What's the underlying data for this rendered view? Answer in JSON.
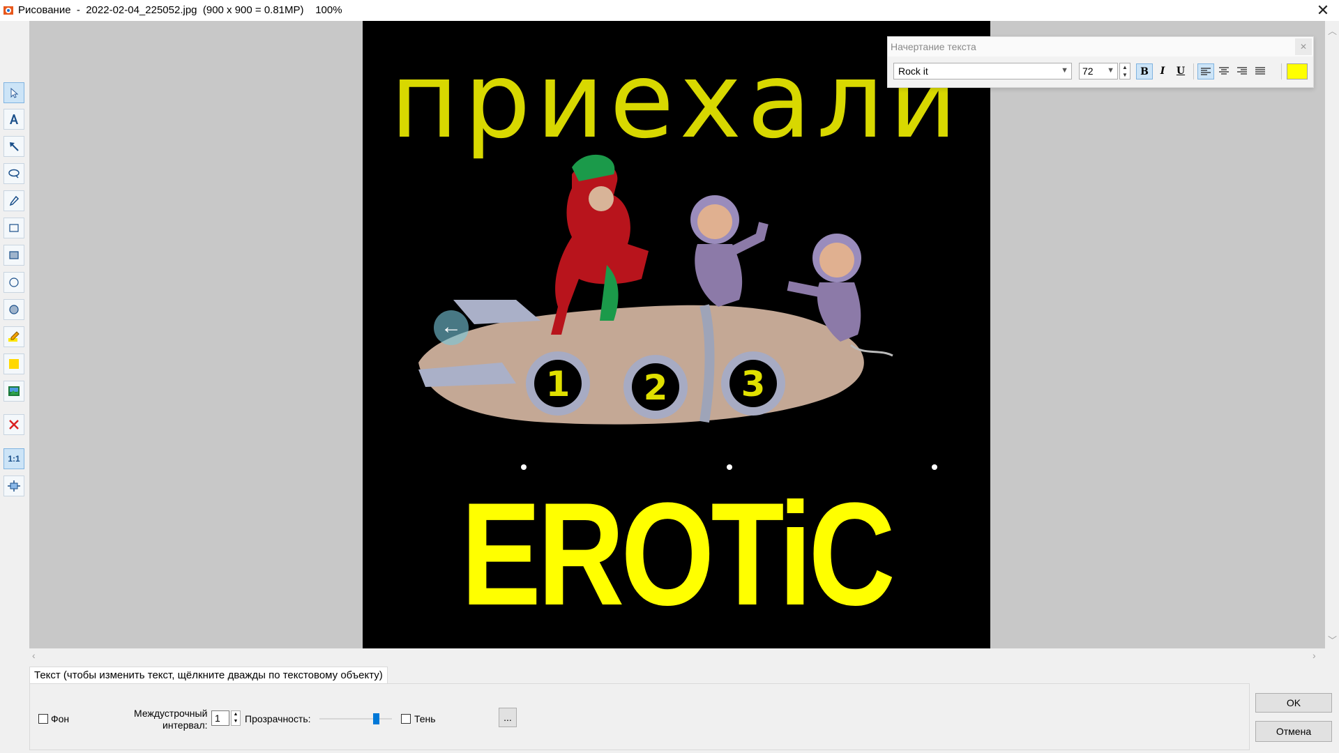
{
  "window": {
    "title": "Рисование  -  2022-02-04_225052.jpg  (900 x 900 = 0.81MP)    100%",
    "close_glyph": "✕"
  },
  "toolbar": {
    "icons": [
      "pointer-icon",
      "text-tool-icon",
      "arrow-tool-icon",
      "lasso-icon",
      "pen-icon",
      "rectangle-icon",
      "filled-rectangle-icon",
      "ellipse-icon",
      "filled-ellipse-icon",
      "highlighter-icon",
      "fill-color-icon",
      "insert-image-icon",
      "delete-icon",
      "actual-size-icon",
      "fit-to-window-icon"
    ],
    "actual_size_label": "1:1"
  },
  "image": {
    "top_text": "приехали",
    "bottom_text": "EROTiC",
    "porthole_numbers": [
      "1",
      "2",
      "3"
    ],
    "back_glyph": "←"
  },
  "text_style_panel": {
    "title": "Начертание текста",
    "close_glyph": "✕",
    "font": "Rock it",
    "size": "72",
    "bold_label": "B",
    "italic_label": "I",
    "underline_label": "U",
    "text_color": "#ffff00"
  },
  "bottom": {
    "tab_label": "Текст (чтобы изменить текст, щёлкните дважды по текстовому объекту)",
    "background_label": "Фон",
    "line_spacing_label_1": "Междустрочный",
    "line_spacing_label_2": "интервал:",
    "line_spacing_value": "1",
    "transparency_label": "Прозрачность:",
    "transparency_level": 0.78,
    "shadow_label": "Тень",
    "more_button": "...",
    "ok_button": "OK",
    "cancel_button": "Отмена"
  }
}
